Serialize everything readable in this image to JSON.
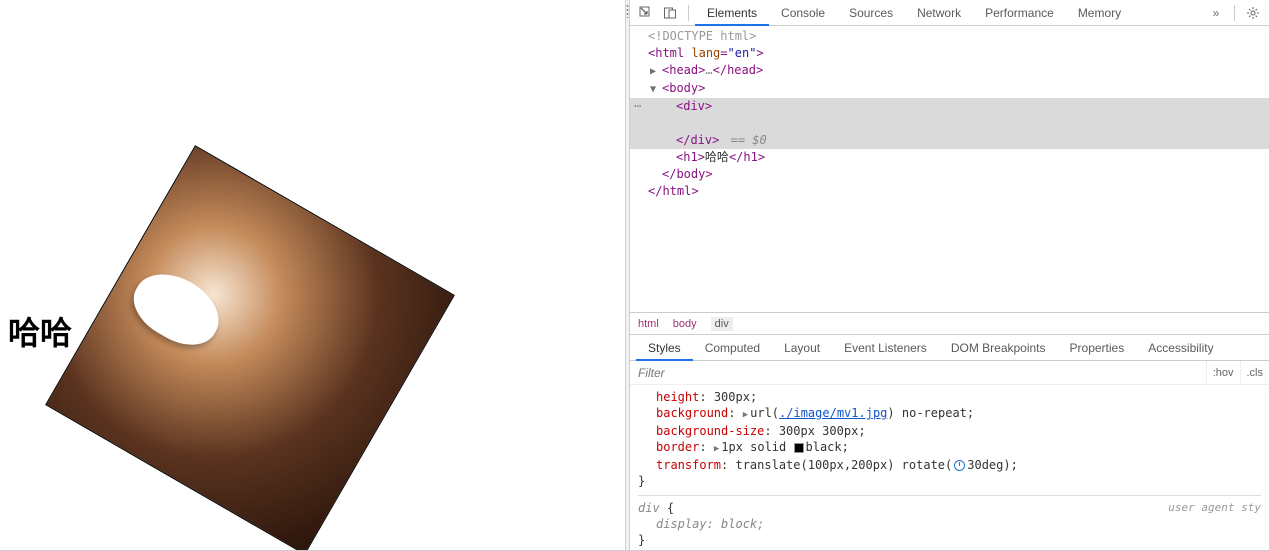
{
  "page": {
    "h1_text": "哈哈"
  },
  "devtools": {
    "tabs": [
      "Elements",
      "Console",
      "Sources",
      "Network",
      "Performance",
      "Memory"
    ],
    "active_tab": "Elements",
    "more_glyph": "»",
    "breadcrumb": [
      "html",
      "body",
      "div"
    ],
    "dom": {
      "doctype": "<!DOCTYPE html>",
      "html_open_tag": "html",
      "html_open_attr_name": "lang",
      "html_open_attr_val": "\"en\"",
      "head_collapsed_open": "head",
      "head_collapsed_ellipsis": "…",
      "head_collapsed_close": "head",
      "body_open": "body",
      "div_open": "div",
      "div_close": "div",
      "selected_suffix": " == $0",
      "h1_tag": "h1",
      "h1_text": "哈哈",
      "body_close": "body",
      "html_close": "html",
      "gutter_dots": "⋯"
    },
    "styles_panel": {
      "tabs": [
        "Styles",
        "Computed",
        "Layout",
        "Event Listeners",
        "DOM Breakpoints",
        "Properties",
        "Accessibility"
      ],
      "active_tab": "Styles",
      "filter_placeholder": "Filter",
      "hov_label": ":hov",
      "cls_label": ".cls",
      "rule_lines": {
        "height_prop": "height",
        "height_val": "300px",
        "background_prop": "background",
        "background_url_prefix": "url(",
        "background_url_link": "./image/mv1.jpg",
        "background_url_suffix": ")",
        "background_repeat": "no-repeat",
        "bgsize_prop": "background-size",
        "bgsize_val": "300px 300px",
        "border_prop": "border",
        "border_val_width": "1px solid",
        "border_val_color_name": "black",
        "transform_prop": "transform",
        "transform_val_a": "translate(100px,200px)",
        "transform_val_b_prefix": "rotate(",
        "transform_val_b_angle": "30deg",
        "transform_val_b_suffix": ")"
      },
      "ua_rule": {
        "selector": "div",
        "label": "user agent sty",
        "display_prop": "display",
        "display_val": "block"
      }
    }
  }
}
